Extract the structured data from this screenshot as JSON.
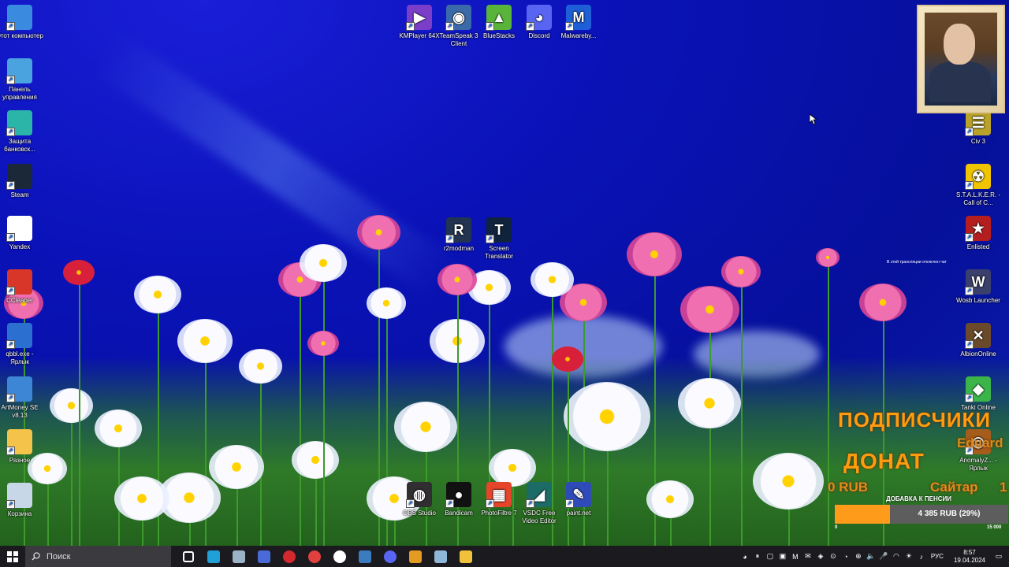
{
  "desktop_icons_left": [
    {
      "label": "Этот компьютер",
      "icon": "computer-icon",
      "color": "#3a8be0"
    },
    {
      "label": "Панель управления",
      "icon": "control-panel-icon",
      "color": "#4aa3df"
    },
    {
      "label": "Защита банковск...",
      "icon": "bank-protection-icon",
      "color": "#2bb5a8"
    },
    {
      "label": "Steam",
      "icon": "steam-icon",
      "color": "#1b2838"
    },
    {
      "label": "Yandex",
      "icon": "yandex-icon",
      "color": "#ffffff"
    },
    {
      "label": "CCleaner",
      "icon": "ccleaner-icon",
      "color": "#d9362a"
    },
    {
      "label": "qbbl.exe - Ярлык",
      "icon": "qbbl-icon",
      "color": "#2b6fd1"
    },
    {
      "label": "ArtMoney SE v8.13",
      "icon": "artmoney-icon",
      "color": "#3d86d6"
    },
    {
      "label": "Разное",
      "icon": "folder-icon",
      "color": "#f3c34a"
    },
    {
      "label": "Корзина",
      "icon": "recycle-bin-icon",
      "color": "#c7d7e8"
    }
  ],
  "desktop_icons_top": [
    {
      "label": "KMPlayer 64X",
      "icon": "kmplayer-icon",
      "color": "#7a3ec8",
      "glyph": "▶"
    },
    {
      "label": "TeamSpeak 3 Client",
      "icon": "teamspeak-icon",
      "color": "#3a6aa8",
      "glyph": "◉"
    },
    {
      "label": "BlueStacks",
      "icon": "bluestacks-icon",
      "color": "#59b43a",
      "glyph": "▲"
    },
    {
      "label": "Discord",
      "icon": "discord-icon",
      "color": "#5865f2",
      "glyph": "◕"
    },
    {
      "label": "Malwareby...",
      "icon": "malwarebytes-icon",
      "color": "#1e5fd8",
      "glyph": "M"
    }
  ],
  "desktop_icons_middle": [
    {
      "label": "r2modman",
      "icon": "r2modman-icon",
      "color": "#22344f",
      "glyph": "R"
    },
    {
      "label": "Screen Translator",
      "icon": "screen-translator-icon",
      "color": "#10233c",
      "glyph": "T"
    }
  ],
  "desktop_icons_right": [
    {
      "label": "Civ 3",
      "icon": "civ3-icon",
      "color": "#b8a22a",
      "glyph": "☰"
    },
    {
      "label": "S.T.A.L.K.E.R. - Call of C...",
      "icon": "stalker-icon",
      "color": "#f0c500",
      "glyph": "☢"
    },
    {
      "label": "Enlisted",
      "icon": "enlisted-icon",
      "color": "#b51e1e",
      "glyph": "★"
    },
    {
      "label": "Wosb Launcher",
      "icon": "wosb-icon",
      "color": "#3b3f6b",
      "glyph": "W"
    },
    {
      "label": "AlbionOnline",
      "icon": "albion-icon",
      "color": "#6b4a2c",
      "glyph": "✕"
    },
    {
      "label": "Tanki Online",
      "icon": "tanki-icon",
      "color": "#3bb54a",
      "glyph": "◆"
    },
    {
      "label": "AnomalyZ... - Ярлык",
      "icon": "anomaly-icon",
      "color": "#a65c1a",
      "glyph": "◎"
    }
  ],
  "desktop_icons_bottom": [
    {
      "label": "OBS Studio",
      "icon": "obs-icon",
      "color": "#302e31",
      "glyph": "◍"
    },
    {
      "label": "Bandicam",
      "icon": "bandicam-icon",
      "color": "#111111",
      "glyph": "●"
    },
    {
      "label": "PhotoFiltre 7",
      "icon": "photofiltre-icon",
      "color": "#e5452b",
      "glyph": "▦"
    },
    {
      "label": "VSDC Free Video Editor",
      "icon": "vsdc-icon",
      "color": "#1c6b66",
      "glyph": "◢"
    },
    {
      "label": "paint.net",
      "icon": "paintnet-icon",
      "color": "#2e4bb8",
      "glyph": "✎"
    }
  ],
  "overlay": {
    "stream_note": "В этой трансляции отключен чат",
    "subscribers": "ПОДПИСЧИКИ",
    "name": "Eduard",
    "donate": "ДОНАТ",
    "rub_partial": "0 RUB",
    "site": "Сайтар",
    "site_num": "1",
    "pension_label": "ДОБАВКА К ПЕНСИИ",
    "donation_value": "4 385 RUB (29%)",
    "donation_percent": 29,
    "range_min": "0",
    "range_max": "15 000",
    "accent": "#ff9b0f"
  },
  "taskbar": {
    "search_placeholder": "Поиск",
    "pinned": [
      {
        "icon": "task-view-icon",
        "color": "#ffffff"
      },
      {
        "icon": "edge-icon",
        "color": "#1fa0d6"
      },
      {
        "icon": "settings-tool-icon",
        "color": "#9bb3c7"
      },
      {
        "icon": "kmplayer-icon",
        "color": "#4a6ad8"
      },
      {
        "icon": "record-icon",
        "color": "#d3282e"
      },
      {
        "icon": "speedometer-icon",
        "color": "#e2403f"
      },
      {
        "icon": "yandex-icon",
        "color": "#ffffff"
      },
      {
        "icon": "steam-icon",
        "color": "#3b7cbf"
      },
      {
        "icon": "discord-icon",
        "color": "#5865f2"
      },
      {
        "icon": "game-icon",
        "color": "#e39b22"
      },
      {
        "icon": "notepad-icon",
        "color": "#8fb7d8"
      },
      {
        "icon": "file-explorer-icon",
        "color": "#f2c13c"
      }
    ],
    "language": "РУС",
    "time": "8:57",
    "date": "19.04.2024"
  }
}
